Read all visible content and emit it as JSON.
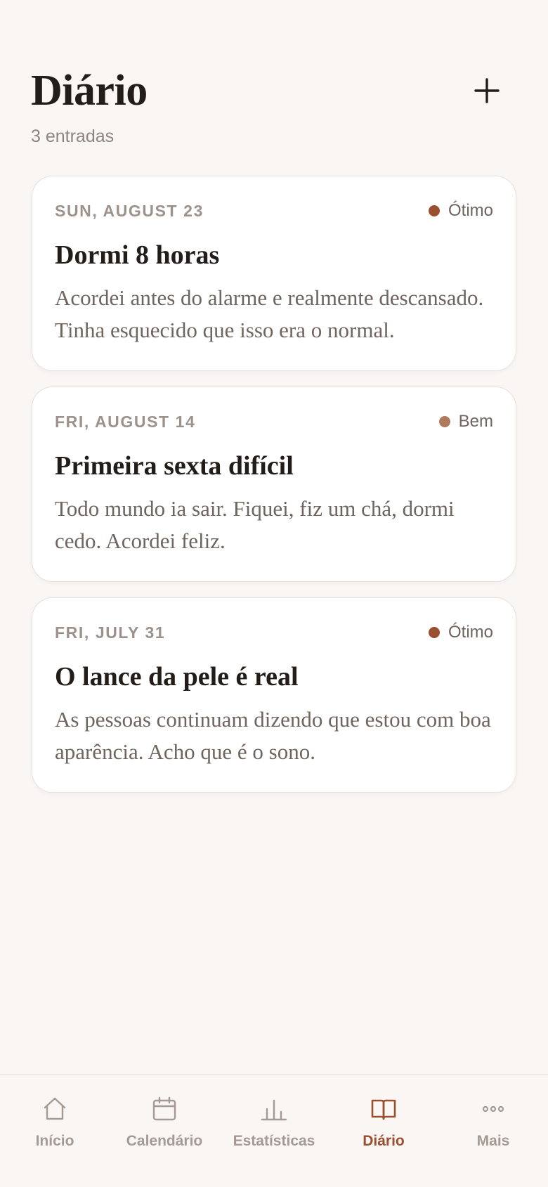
{
  "header": {
    "title": "Diário",
    "count_label": "3 entradas",
    "add_icon": "plus-icon"
  },
  "entries": [
    {
      "date": "SUN, AUGUST 23",
      "mood": "Ótimo",
      "mood_color": "#9a4f2e",
      "title": "Dormi 8 horas",
      "body": "Acordei antes do alarme e realmente descansado. Tinha esquecido que isso era o normal."
    },
    {
      "date": "FRI, AUGUST 14",
      "mood": "Bem",
      "mood_color": "#b07a5c",
      "title": "Primeira sexta difícil",
      "body": "Todo mundo ia sair. Fiquei, fiz um chá, dormi cedo. Acordei feliz."
    },
    {
      "date": "FRI, JULY 31",
      "mood": "Ótimo",
      "mood_color": "#9a4f2e",
      "title": "O lance da pele é real",
      "body": "As pessoas continuam dizendo que estou com boa aparência. Acho que é o sono."
    }
  ],
  "tabs": [
    {
      "label": "Início",
      "icon": "home-icon"
    },
    {
      "label": "Calendário",
      "icon": "calendar-icon"
    },
    {
      "label": "Estatísticas",
      "icon": "bar-chart-icon"
    },
    {
      "label": "Diário",
      "icon": "book-icon",
      "active": true
    },
    {
      "label": "Mais",
      "icon": "more-icon"
    }
  ],
  "colors": {
    "accent": "#9a4f2e",
    "background": "#f9f6f4",
    "card": "#ffffff",
    "inactive_tab": "#a49a93"
  }
}
